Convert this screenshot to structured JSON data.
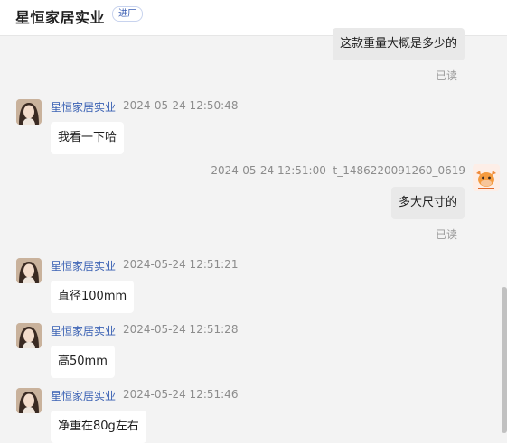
{
  "header": {
    "title": "星恒家居实业",
    "badge": "进厂"
  },
  "messages": [
    {
      "text": "这款重量大概是多少的",
      "status": "已读"
    },
    {
      "sender": "星恒家居实业",
      "time": "2024-05-24 12:50:48",
      "text": "我看一下哈"
    },
    {
      "time": "2024-05-24 12:51:00",
      "sender": "t_1486220091260_0619",
      "text": "多大尺寸的",
      "status": "已读"
    },
    {
      "sender": "星恒家居实业",
      "time": "2024-05-24 12:51:21",
      "text": "直径100mm"
    },
    {
      "sender": "星恒家居实业",
      "time": "2024-05-24 12:51:28",
      "text": "高50mm"
    },
    {
      "sender": "星恒家居实业",
      "time": "2024-05-24 12:51:46",
      "text": "净重在80g左右"
    }
  ],
  "icons": {
    "avatar_shop": "woman-portrait-avatar",
    "avatar_user": "cartoon-cow-avatar"
  }
}
